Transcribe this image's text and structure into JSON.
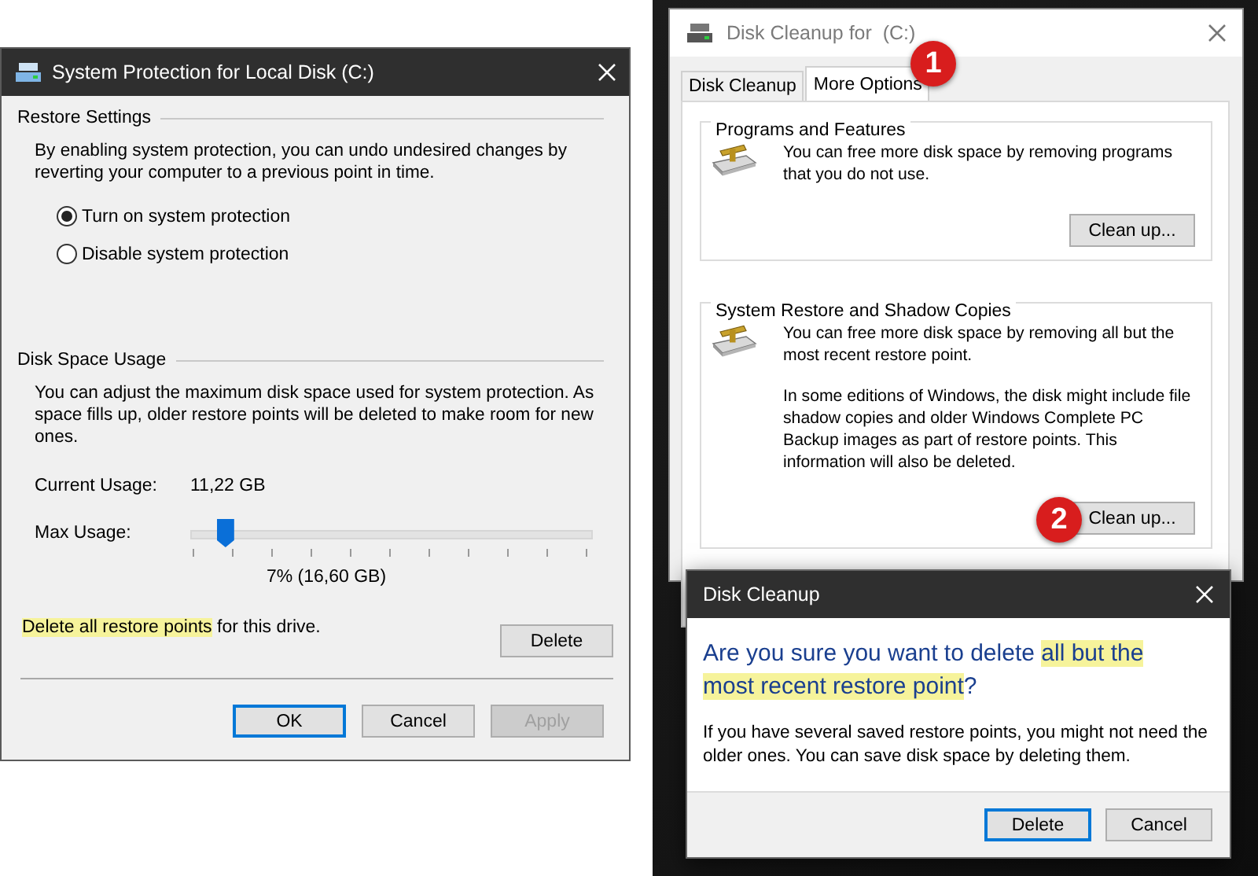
{
  "protection_window": {
    "title": "System Protection for Local Disk (C:)",
    "restore_settings": {
      "heading": "Restore Settings",
      "description": "By enabling system protection, you can undo undesired changes by reverting your computer to a previous point in time.",
      "options": [
        {
          "label": "Turn on system protection",
          "selected": true
        },
        {
          "label": "Disable system protection",
          "selected": false
        }
      ]
    },
    "disk_space_usage": {
      "heading": "Disk Space Usage",
      "description": "You can adjust the maximum disk space used for system protection. As space fills up, older restore points will be deleted to make room for new ones.",
      "current_usage_label": "Current Usage:",
      "current_usage_value": "11,22 GB",
      "max_usage_label": "Max Usage:",
      "max_usage": {
        "level": 0.07
      },
      "max_usage_reading": "7% (16,60 GB)",
      "delete_text": [
        {
          "text": "Delete all restore points",
          "highlight": true
        },
        {
          "text": " for this drive.",
          "highlight": false
        }
      ],
      "delete_button": "Delete"
    },
    "buttons": [
      {
        "label": "OK",
        "default": true,
        "disabled": false
      },
      {
        "label": "Cancel",
        "default": false,
        "disabled": false
      },
      {
        "label": "Apply",
        "default": false,
        "disabled": true
      }
    ]
  },
  "cleanup_window": {
    "title": "Disk Cleanup for  (C:)",
    "tabs": [
      {
        "label": "Disk Cleanup",
        "selected": false
      },
      {
        "label": "More Options",
        "selected": true
      }
    ],
    "sections": [
      {
        "heading": "Programs and Features",
        "paragraphs": [
          "You can free more disk space by removing programs that you do not use."
        ],
        "button": "Clean up..."
      },
      {
        "heading": "System Restore and Shadow Copies",
        "paragraphs": [
          "You can free more disk space by removing all but the most recent restore point.",
          "In some editions of Windows, the disk might include file shadow copies and older Windows Complete PC Backup images as part of restore points. This information will also be deleted."
        ],
        "button": "Clean up..."
      }
    ]
  },
  "confirm_dialog": {
    "title": "Disk Cleanup",
    "question": [
      {
        "text": "Are you sure you want to delete ",
        "highlight": false
      },
      {
        "text": "all but the most recent restore point",
        "highlight": true
      },
      {
        "text": "?",
        "highlight": false
      }
    ],
    "detail": "If you have several saved restore points, you might not need the older ones. You can save disk space by deleting them.",
    "buttons": [
      {
        "label": "Delete",
        "default": true
      },
      {
        "label": "Cancel",
        "default": false
      }
    ]
  },
  "callouts": [
    {
      "number": "1"
    },
    {
      "number": "2"
    }
  ]
}
